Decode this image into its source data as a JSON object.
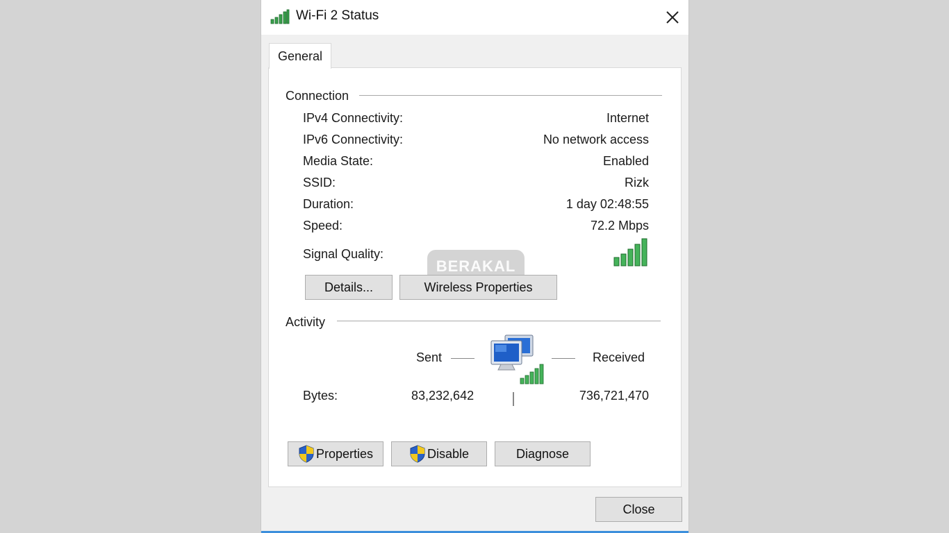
{
  "window": {
    "title": "Wi-Fi 2 Status"
  },
  "tabs": [
    {
      "label": "General"
    }
  ],
  "connection": {
    "title": "Connection",
    "rows": [
      {
        "label": "IPv4 Connectivity:",
        "value": "Internet"
      },
      {
        "label": "IPv6 Connectivity:",
        "value": "No network access"
      },
      {
        "label": "Media State:",
        "value": "Enabled"
      },
      {
        "label": "SSID:",
        "value": "Rizk"
      },
      {
        "label": "Duration:",
        "value": "1 day 02:48:55"
      },
      {
        "label": "Speed:",
        "value": "72.2 Mbps"
      }
    ],
    "signal_label": "Signal Quality:",
    "signal_bars_lit": 5,
    "signal_bars_total": 5,
    "details_button": "Details...",
    "wireless_button": "Wireless Properties"
  },
  "watermark": "BERAKAL",
  "activity": {
    "title": "Activity",
    "sent_label": "Sent",
    "received_label": "Received",
    "bytes_label": "Bytes:",
    "bytes_sent": "83,232,642",
    "bytes_received": "736,721,470"
  },
  "buttons": {
    "properties": "Properties",
    "disable": "Disable",
    "diagnose": "Diagnose",
    "close": "Close"
  },
  "icons": {
    "title": "signal-bars-icon",
    "close": "close-icon",
    "signal": "signal-quality-icon",
    "network": "network-computers-icon",
    "shield": "uac-shield-icon"
  },
  "colors": {
    "signal_green": "#2e9a48",
    "accent_blue": "#3c8fdc",
    "shield_blue": "#2a62c8",
    "shield_yellow": "#f2c81e"
  }
}
